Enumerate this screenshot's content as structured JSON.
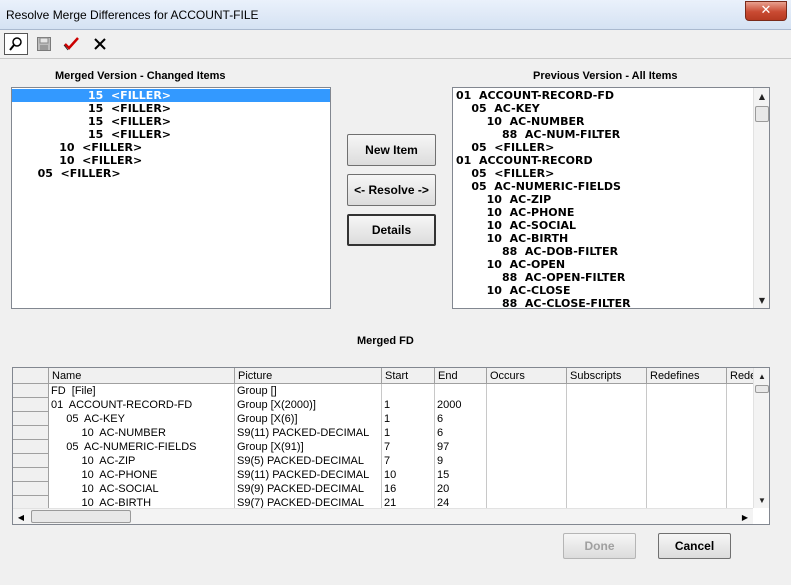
{
  "window": {
    "title": "Resolve Merge Differences for ACCOUNT-FILE",
    "close_glyph": "✕"
  },
  "toolbar": {
    "buttons": [
      {
        "name": "find-icon"
      },
      {
        "name": "save-icon"
      },
      {
        "name": "check-icon"
      },
      {
        "name": "delete-icon"
      }
    ]
  },
  "merged_panel": {
    "label": "Merged Version - Changed Items",
    "items": [
      {
        "indent": 10,
        "text": "15  <FILLER>",
        "selected": true
      },
      {
        "indent": 10,
        "text": "15  <FILLER>",
        "selected": false
      },
      {
        "indent": 10,
        "text": "15  <FILLER>",
        "selected": false
      },
      {
        "indent": 10,
        "text": "15  <FILLER>",
        "selected": false
      },
      {
        "indent": 6,
        "text": "10  <FILLER>",
        "selected": false
      },
      {
        "indent": 6,
        "text": "10  <FILLER>",
        "selected": false
      },
      {
        "indent": 3,
        "text": "05  <FILLER>",
        "selected": false
      }
    ]
  },
  "previous_panel": {
    "label": "Previous Version - All Items",
    "items": [
      "01  ACCOUNT-RECORD-FD",
      "    05  AC-KEY",
      "        10  AC-NUMBER",
      "            88  AC-NUM-FILTER",
      "    05  <FILLER>",
      "01  ACCOUNT-RECORD",
      "    05  <FILLER>",
      "    05  AC-NUMERIC-FIELDS",
      "        10  AC-ZIP",
      "        10  AC-PHONE",
      "        10  AC-SOCIAL",
      "        10  AC-BIRTH",
      "            88  AC-DOB-FILTER",
      "        10  AC-OPEN",
      "            88  AC-OPEN-FILTER",
      "        10  AC-CLOSE",
      "            88  AC-CLOSE-FILTER"
    ]
  },
  "actions": {
    "new_item": "New Item",
    "resolve": "<- Resolve ->",
    "details": "Details"
  },
  "merged_fd": {
    "label": "Merged FD",
    "columns": [
      "Name",
      "Picture",
      "Start",
      "End",
      "Occurs",
      "Subscripts",
      "Redefines",
      "Rede"
    ],
    "rows": [
      {
        "name": "FD  [File]",
        "picture": "Group []",
        "start": "",
        "end": ""
      },
      {
        "name": "01  ACCOUNT-RECORD-FD",
        "picture": "Group [X(2000)]",
        "start": "1",
        "end": "2000"
      },
      {
        "name": "     05  AC-KEY",
        "picture": "Group [X(6)]",
        "start": "1",
        "end": "6"
      },
      {
        "name": "          10  AC-NUMBER",
        "picture": "S9(11) PACKED-DECIMAL",
        "start": "1",
        "end": "6"
      },
      {
        "name": "     05  AC-NUMERIC-FIELDS",
        "picture": "Group [X(91)]",
        "start": "7",
        "end": "97"
      },
      {
        "name": "          10  AC-ZIP",
        "picture": "S9(5) PACKED-DECIMAL",
        "start": "7",
        "end": "9"
      },
      {
        "name": "          10  AC-PHONE",
        "picture": "S9(11) PACKED-DECIMAL",
        "start": "10",
        "end": "15"
      },
      {
        "name": "          10  AC-SOCIAL",
        "picture": "S9(9) PACKED-DECIMAL",
        "start": "16",
        "end": "20"
      },
      {
        "name": "          10  AC-BIRTH",
        "picture": "S9(7) PACKED-DECIMAL",
        "start": "21",
        "end": "24"
      }
    ]
  },
  "footer": {
    "done": "Done",
    "cancel": "Cancel"
  },
  "colors": {
    "selection": "#3399ff",
    "close": "#c94a32"
  }
}
